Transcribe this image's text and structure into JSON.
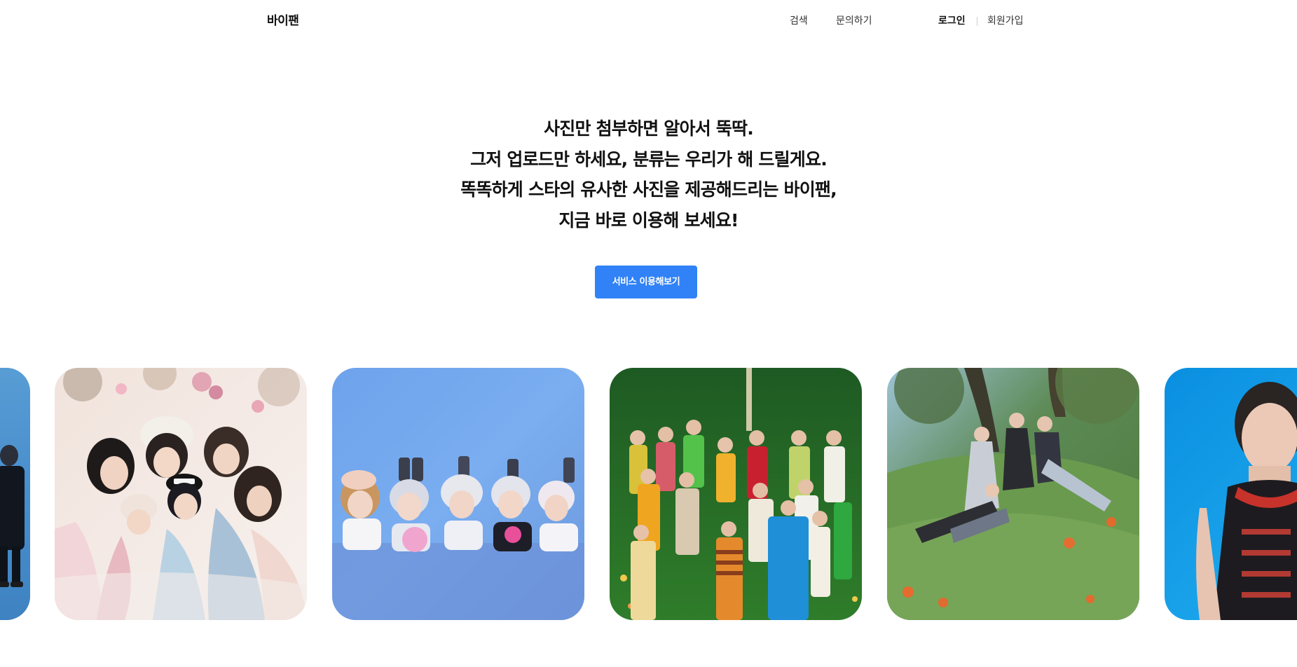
{
  "header": {
    "logo": "바이팬",
    "nav": {
      "search": "검색",
      "inquiry": "문의하기"
    },
    "auth": {
      "login": "로그인",
      "signup": "회원가입"
    }
  },
  "hero": {
    "lines": [
      "사진만 첨부하면 알아서 뚝딱.",
      "그저 업로드만 하세요, 분류는 우리가 해 드릴게요.",
      "똑똑하게 스타의 유사한 사진을 제공해드리는 바이팬,",
      "지금 바로 이용해 보세요!"
    ],
    "cta_label": "서비스 이용해보기"
  },
  "colors": {
    "accent": "#3182f6",
    "text": "#111111",
    "nav_text": "#333333",
    "background": "#ffffff"
  },
  "gallery": {
    "photos": [
      {
        "scene": "blue-outdoor-group-photo"
      },
      {
        "scene": "pastel-floral-group-photo"
      },
      {
        "scene": "blue-studio-group-photo"
      },
      {
        "scene": "garden-colorful-suits-group-photo"
      },
      {
        "scene": "hillside-forest-group-photo"
      },
      {
        "scene": "cyan-portrait-photo"
      }
    ]
  }
}
